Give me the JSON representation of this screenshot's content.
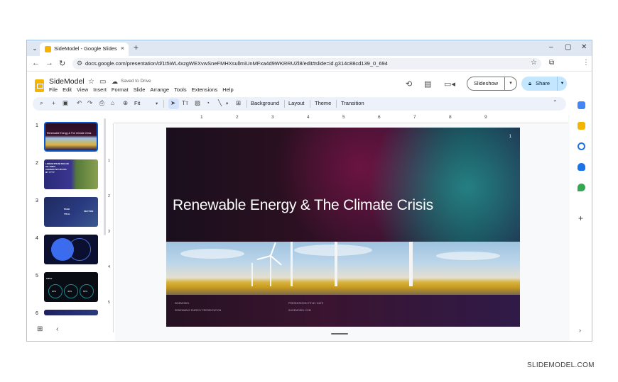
{
  "browser": {
    "tab_title": "SideModel - Google Slides",
    "new_tab": "+",
    "close_tab": "×",
    "url": "docs.google.com/presentation/d/1t5WL4xzgWEXvwSneFMHXsullmiUnMFxa4d9WKRRUZl8/edit#slide=id.g314c88cd139_0_694",
    "window_controls": [
      "–",
      "▢",
      "✕"
    ]
  },
  "app": {
    "doc_title": "SideModel",
    "saved_status": "Saved to Drive",
    "menu": [
      "File",
      "Edit",
      "View",
      "Insert",
      "Format",
      "Slide",
      "Arrange",
      "Tools",
      "Extensions",
      "Help"
    ],
    "slideshow_label": "Slideshow",
    "share_label": "Share"
  },
  "toolbar": {
    "zoom": "Fit",
    "background": "Background",
    "layout": "Layout",
    "theme": "Theme",
    "transition": "Transition"
  },
  "filmstrip": {
    "numbers": [
      "1",
      "2",
      "3",
      "4",
      "5",
      "6"
    ],
    "thumb1_title": "Renewable Energy & The Climate Crisis",
    "thumb2_text": "LOREM IPSUM DOLOR SIT AMET, CONSECTETUR 20% BY YYYY",
    "thumb3_text_a": "PAGE TITLE",
    "thumb3_text_b": "SECTION",
    "thumb5_title": "TITLE",
    "thumb5_values": [
      "20%",
      "40%",
      "60%"
    ]
  },
  "ruler": {
    "h": [
      "1",
      "2",
      "3",
      "4",
      "5",
      "6",
      "7",
      "8",
      "9"
    ],
    "v": [
      "1",
      "2",
      "3",
      "4",
      "5"
    ]
  },
  "slide": {
    "number": "1",
    "title": "Renewable Energy & The Climate Crisis",
    "footer_left_1": "SIDEMODEL",
    "footer_left_2": "RENEWABLE ENERGY PRESENTATION",
    "footer_right_1": "PRESENTATION TITLE / DATE",
    "footer_right_2": "SLIDEMODEL.COM"
  },
  "watermark": "SLIDEMODEL.COM",
  "colors": {
    "accent": "#0b57d0",
    "share_bg": "#c2e7ff",
    "docs_yellow": "#f4b400"
  }
}
